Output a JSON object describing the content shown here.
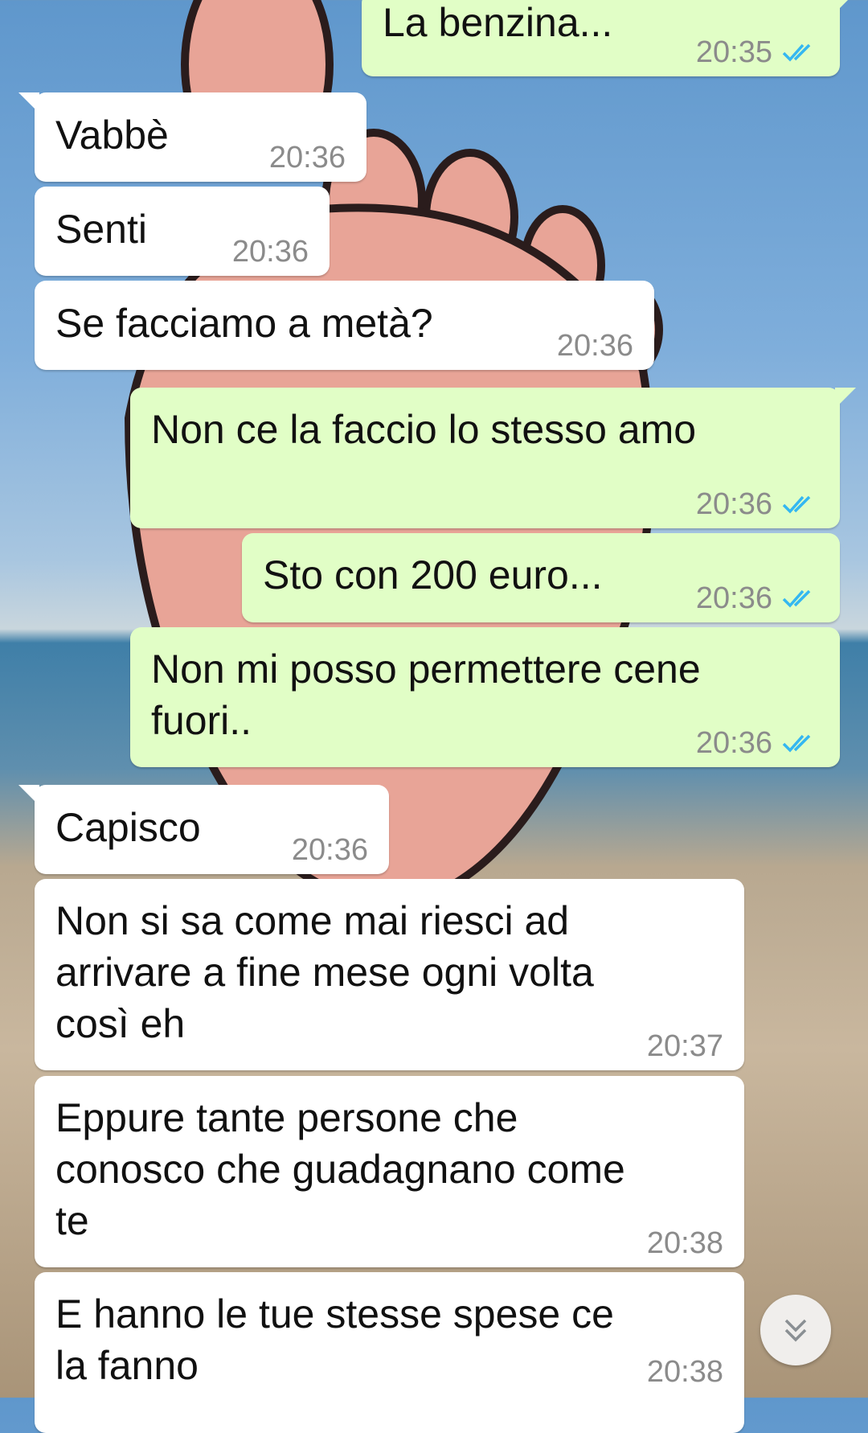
{
  "messages": [
    {
      "text": "La benzina...",
      "time": "20:35",
      "direction": "out"
    },
    {
      "text": "Vabbè",
      "time": "20:36",
      "direction": "in"
    },
    {
      "text": "Senti",
      "time": "20:36",
      "direction": "in"
    },
    {
      "text": "Se facciamo a metà?",
      "time": "20:36",
      "direction": "in"
    },
    {
      "text": "Non ce la faccio lo stesso amo",
      "time": "20:36",
      "direction": "out"
    },
    {
      "text": "Sto con 200 euro...",
      "time": "20:36",
      "direction": "out"
    },
    {
      "text": "Non mi posso permettere cene fuori..",
      "time": "20:36",
      "direction": "out"
    },
    {
      "text": "Capisco",
      "time": "20:36",
      "direction": "in"
    },
    {
      "text": "Non si sa come mai riesci ad arrivare a fine mese ogni volta così eh",
      "time": "20:37",
      "direction": "in"
    },
    {
      "text": "Eppure tante persone che conosco che guadagnano come te",
      "time": "20:38",
      "direction": "in"
    },
    {
      "text": "E hanno le tue stesse spese ce la fanno",
      "time": "20:38",
      "direction": "in"
    }
  ],
  "colors": {
    "incoming_bubble": "#ffffff",
    "outgoing_bubble": "#e1fec6",
    "read_ticks": "#34b7f1",
    "timestamp": "#8b8b8b"
  },
  "icons": {
    "read_receipt": "double-check-icon",
    "scroll_down": "chevron-double-down-icon"
  }
}
